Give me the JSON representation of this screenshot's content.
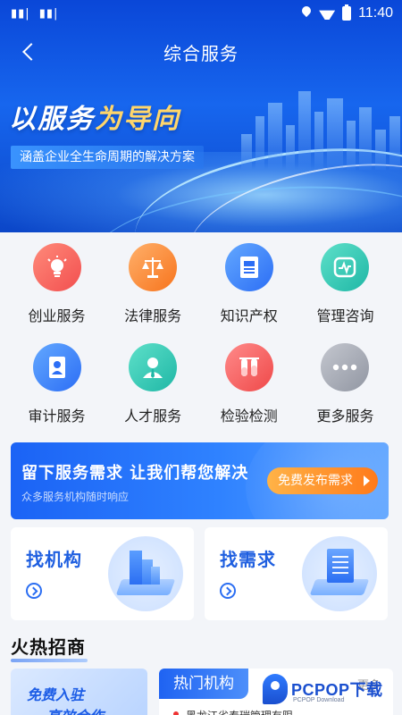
{
  "status_bar": {
    "time": "11:40"
  },
  "nav": {
    "title": "综合服务"
  },
  "banner": {
    "slogan_part1": "以服务",
    "slogan_part2": "为导向",
    "subtitle": "涵盖企业全生命周期的解决方案"
  },
  "services": [
    {
      "label": "创业服务",
      "icon": "lightbulb-icon",
      "color": "#f24f4f"
    },
    {
      "label": "法律服务",
      "icon": "scales-icon",
      "color": "#f7741d"
    },
    {
      "label": "知识产权",
      "icon": "document-icon",
      "color": "#2c6ef5"
    },
    {
      "label": "管理咨询",
      "icon": "chart-badge-icon",
      "color": "#1fb7a6"
    },
    {
      "label": "审计服务",
      "icon": "id-card-icon",
      "color": "#2c6ef5"
    },
    {
      "label": "人才服务",
      "icon": "person-icon",
      "color": "#1fb7a6"
    },
    {
      "label": "检验检测",
      "icon": "test-tube-icon",
      "color": "#ef4949"
    },
    {
      "label": "更多服务",
      "icon": "more-dots-icon",
      "color": "#9196a2"
    }
  ],
  "cta": {
    "title": "留下服务需求  让我们帮您解决",
    "subtitle": "众多服务机构随时响应",
    "button": "免费发布需求"
  },
  "find_cards": [
    {
      "title": "找机构"
    },
    {
      "title": "找需求"
    }
  ],
  "hot_section": {
    "title": "火热招商",
    "promo_line1": "免费入驻",
    "promo_line2": "高效合作",
    "tab": "热门机构",
    "more": "更多",
    "item": "黑龙江省泰瑞管理有限"
  },
  "watermark": {
    "brand": "PCPOP下载",
    "sub": "PCPOP Download"
  }
}
